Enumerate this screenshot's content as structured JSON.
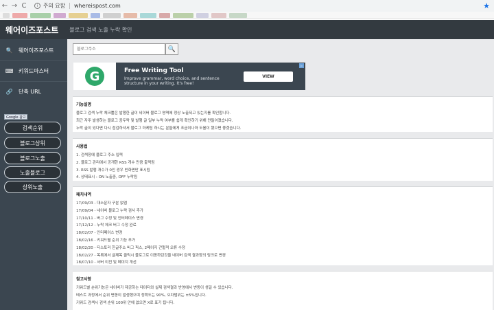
{
  "browser": {
    "back": "←",
    "forward": "→",
    "reload": "C",
    "info_icon": "i",
    "security_label": "주의 요함",
    "url": "whereispost.com",
    "star": "★",
    "bookmark_colors": [
      "#c8c8c8",
      "#e86a6a",
      "#6ab06a",
      "#b06ab0",
      "#d8b040",
      "#6a8ad8",
      "#b0b0b0",
      "#d88a6a",
      "#6ac0c0",
      "#c06a6a",
      "#8ab06a",
      "#b0b0d0",
      "#d0a0a0",
      "#a0c0a0"
    ]
  },
  "header": {
    "title": "웨어이즈포스트",
    "subtitle": "블로그 검색 노출 누락 확인"
  },
  "sidebar": {
    "items": [
      {
        "icon": "search-icon",
        "glyph": "🔍",
        "label": "웨어이즈포스트"
      },
      {
        "icon": "keyboard-icon",
        "glyph": "⌨",
        "label": "키워드마스터"
      },
      {
        "icon": "link-icon",
        "glyph": "🔗",
        "label": "단축 URL"
      }
    ],
    "google_ad_label": "Google 광고",
    "buttons": [
      "검색순위",
      "블로그상위",
      "블로그노출",
      "노출블로그",
      "상위노출"
    ]
  },
  "search": {
    "placeholder": "블로그주소",
    "button_icon": "🔍"
  },
  "ad": {
    "logo_letter": "G",
    "title": "Free Writing Tool",
    "desc": "Improve grammar, word choice, and sentence structure in your writing. It's free!",
    "cta": "VIEW",
    "choice_mark": "▷"
  },
  "sections": [
    {
      "title": "기능설명",
      "lines": [
        "블로그 검색 누락 체크툴은 발행한 글이 네이버 블로그 영역에 정상 노출되고 있는지를 확인합니다.",
        "최근 자주 발생하는 블로그 중두락 및 발행 글 일부 누락 여부를 쉽게 확인하기 위해 만들어졌습니다.",
        "누락 글이 있다면 다시 점검하셔서 블로그 마케팅 하시는 분들에게 조금이나마 도움이 됐으면 좋겠습니다."
      ]
    },
    {
      "title": "사용법",
      "lines": [
        "1. 검색창에 블로그 주소 입력",
        "2. 블로그 관리에서 공개한 RSS 개수 만큼 출력됨",
        "3. RSS 발행 개수가 0인 경우 빈화면만 표시됨",
        "4. 상태표시 : ON 노출중, OFF 누락됨"
      ]
    },
    {
      "title": "패치내역",
      "lines": [
        "17/09/03 - 대소문자 구분 없앱",
        "17/09/04 - 네이버 블로그 누락 검사 추가",
        "17/10/11 - 버그 수정 및 인터페이스 변경",
        "17/12/12 - 누락 체크 버그 수정 완료",
        "18/02/07 - 인터페이스 변경",
        "18/02/16 - 키워드별 순위 기능 추가",
        "18/02/20 - 티스토리 한글주소 버그 픽스, 2페이지 간헐적 오류 수정",
        "18/02/27 - 목록에서 글제목 클릭시 블로그로 이동하던것을 네이버 검색 결과창의 링크로 변경",
        "18/07/10 - 서버 이전 및 페이지 개선"
      ]
    },
    {
      "title": "참고사항",
      "lines": [
        "키워드별 순위기능은 네이버가 제공하는 데이터와 실제 검색결과 반영에서 변동이 생길 수 있습니다.",
        "테스트 과정에서 순위 변동이 발생했으며 정확도는 90%, 오차범위는 ±5%입니다.",
        "키워드 검색시 검색 순위 100위 안에 없으면 X로 표기 됩니다."
      ]
    }
  ]
}
